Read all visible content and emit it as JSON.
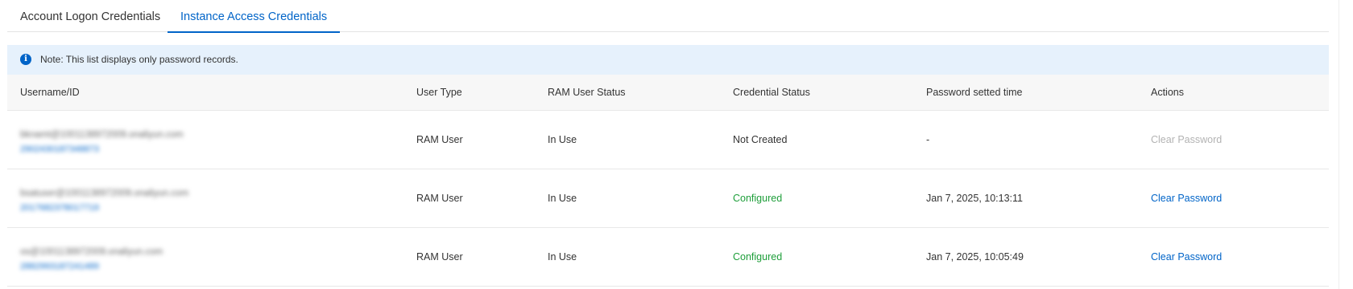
{
  "tabs": [
    {
      "label": "Account Logon Credentials",
      "active": false
    },
    {
      "label": "Instance Access Credentials",
      "active": true
    }
  ],
  "notice": {
    "icon": "info-icon",
    "text": "Note: This list displays only password records."
  },
  "table": {
    "columns": [
      "Username/ID",
      "User Type",
      "RAM User Status",
      "Credential Status",
      "Password setted time",
      "Actions"
    ],
    "rows": [
      {
        "username": "bknamt@1001138972009.onaliyun.com",
        "user_id": "2902430187348873",
        "user_type": "RAM User",
        "ram_status": "In Use",
        "credential_status": "Not Created",
        "password_time": "-",
        "action": "Clear Password",
        "action_enabled": false
      },
      {
        "username": "bsatuser@1001138972009.onaliyun.com",
        "user_id": "2017682378017719",
        "user_type": "RAM User",
        "ram_status": "In Use",
        "credential_status": "Configured",
        "password_time": "Jan 7, 2025, 10:13:11",
        "action": "Clear Password",
        "action_enabled": true
      },
      {
        "username": "os@1001138972009.onaliyun.com",
        "user_id": "2882993187241489",
        "user_type": "RAM User",
        "ram_status": "In Use",
        "credential_status": "Configured",
        "password_time": "Jan 7, 2025, 10:05:49",
        "action": "Clear Password",
        "action_enabled": true
      }
    ]
  },
  "colors": {
    "accent": "#0064c8",
    "success": "#1e9e3a",
    "disabled": "#b3b3b3",
    "notice_bg": "#e6f1fc"
  }
}
